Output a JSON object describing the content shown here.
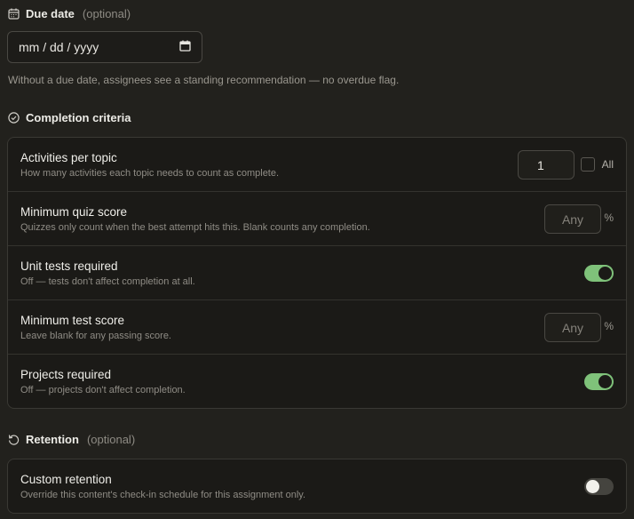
{
  "due_date": {
    "heading": "Due date",
    "optional_label": "(optional)",
    "input_placeholder": "mm / dd / yyyy",
    "hint": "Without a due date, assignees see a standing recommendation — no overdue flag."
  },
  "completion": {
    "heading": "Completion criteria",
    "rows": [
      {
        "title": "Activities per topic",
        "description": "How many activities each topic needs to count as complete.",
        "value": "1",
        "checkbox_label": "All",
        "checked": false
      },
      {
        "title": "Minimum quiz score",
        "description": "Quizzes only count when the best attempt hits this. Blank counts any completion.",
        "placeholder": "Any",
        "unit": "%"
      },
      {
        "title": "Unit tests required",
        "description": "Off — tests don't affect completion at all.",
        "toggle_on": true
      },
      {
        "title": "Minimum test score",
        "description": "Leave blank for any passing score.",
        "placeholder": "Any",
        "unit": "%"
      },
      {
        "title": "Projects required",
        "description": "Off — projects don't affect completion.",
        "toggle_on": true
      }
    ]
  },
  "retention": {
    "heading": "Retention",
    "optional_label": "(optional)",
    "row": {
      "title": "Custom retention",
      "description": "Override this content's check-in schedule for this assignment only.",
      "toggle_on": false
    }
  },
  "colors": {
    "background": "#22211d",
    "card": "#1b1a17",
    "toggle_on": "#7fc27a",
    "toggle_off": "#45443f"
  },
  "icons": [
    "calendar-icon",
    "check-circle-icon",
    "retention-rotate-icon",
    "calendar-picker-icon"
  ]
}
